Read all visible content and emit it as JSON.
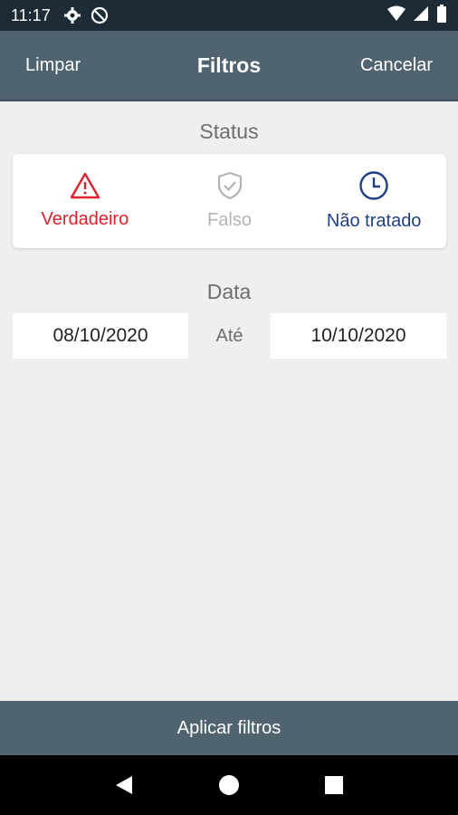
{
  "status_bar": {
    "time": "11:17",
    "icons": [
      "gear-icon",
      "dnd-icon",
      "wifi-icon",
      "signal-icon",
      "battery-icon"
    ]
  },
  "app_bar": {
    "clear_label": "Limpar",
    "title": "Filtros",
    "cancel_label": "Cancelar",
    "background": "#506470"
  },
  "status_section": {
    "label": "Status",
    "options": [
      {
        "label": "Verdadeiro",
        "icon": "warning-icon",
        "color": "#e0202a"
      },
      {
        "label": "Falso",
        "icon": "shield-check-icon",
        "color": "#b3b3b3"
      },
      {
        "label": "Não tratado",
        "icon": "clock-icon",
        "color": "#1f3f86"
      }
    ]
  },
  "date_section": {
    "label": "Data",
    "from": "08/10/2020",
    "separator": "Até",
    "to": "10/10/2020"
  },
  "apply_button": {
    "label": "Aplicar filtros"
  },
  "nav_bar": {
    "icons": [
      "back-icon",
      "home-icon",
      "recents-icon"
    ]
  }
}
